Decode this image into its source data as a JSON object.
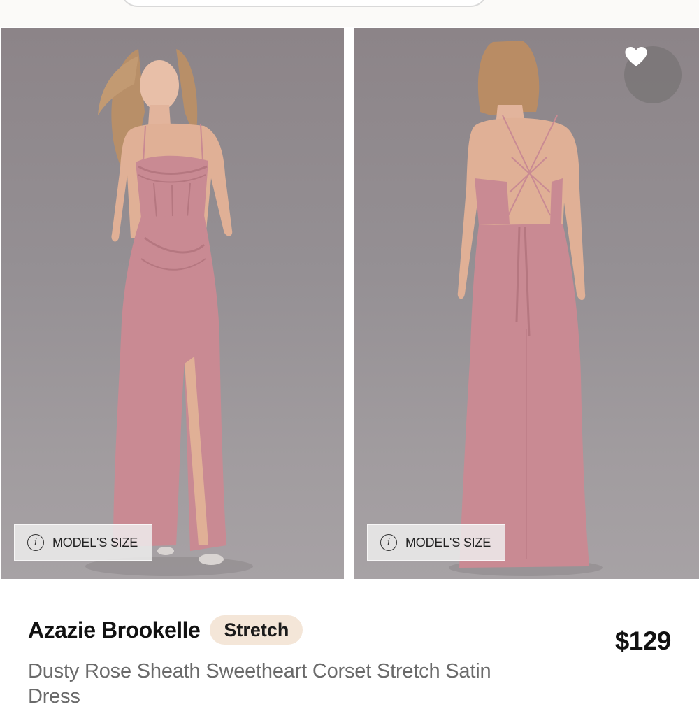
{
  "header": {
    "search_placeholder": ""
  },
  "gallery": {
    "images": [
      {
        "alt": "Model front view",
        "model_size_label": "MODEL'S SIZE"
      },
      {
        "alt": "Model back view",
        "model_size_label": "MODEL'S SIZE"
      }
    ],
    "favorite_icon": "heart-icon",
    "info_icon_glyph": "i"
  },
  "product": {
    "brand": "Azazie Brookelle",
    "badge": "Stretch",
    "price": "$129",
    "title": "Dusty Rose Sheath Sweetheart Corset Stretch Satin Dress"
  },
  "colors": {
    "dress": "#c98a93",
    "badge_bg": "#f4e6d8",
    "background_gray": "#948e92"
  }
}
